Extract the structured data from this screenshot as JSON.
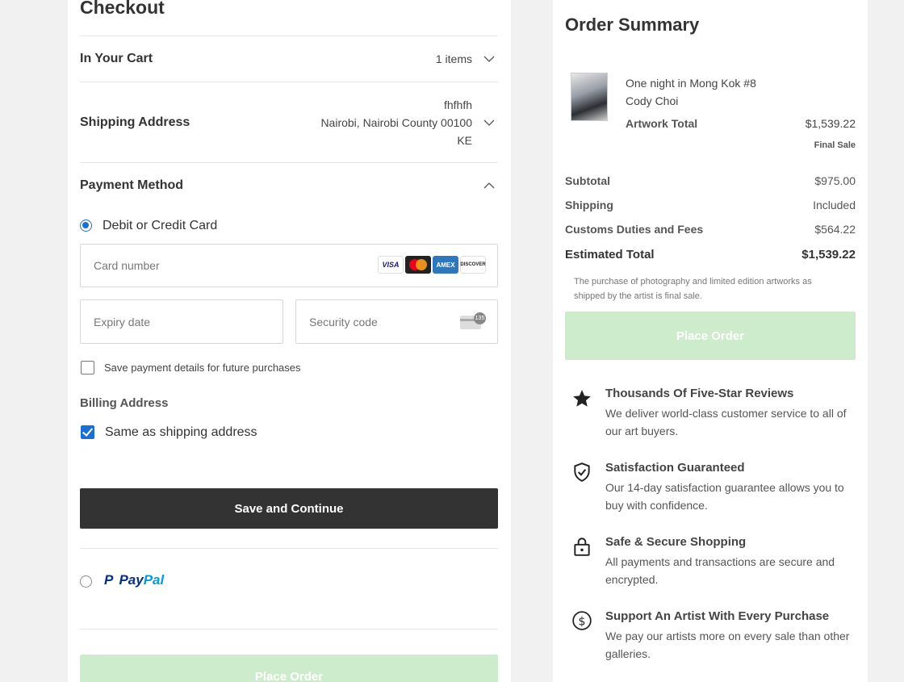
{
  "checkout": {
    "title": "Checkout",
    "cart": {
      "label": "In Your Cart",
      "count": "1 items"
    },
    "shipping": {
      "label": "Shipping Address",
      "line1": "fhfhfh",
      "line2": "Nairobi, Nairobi County 00100",
      "line3": "KE"
    },
    "payment": {
      "label": "Payment Method",
      "card_option": "Debit or Credit Card",
      "card_number_placeholder": "Card number",
      "expiry_placeholder": "Expiry date",
      "security_placeholder": "Security code",
      "card_brands": [
        "VISA",
        "Mastercard",
        "American Express",
        "DISCOVER"
      ],
      "cvv_hint": "135",
      "save_details": "Save payment details for future purchases",
      "billing_label": "Billing Address",
      "same_as_shipping": "Same as shipping address",
      "save_continue": "Save and Continue",
      "paypal_p": "P",
      "paypal_pay": "Pay",
      "paypal_pal": "Pal"
    },
    "place_order": "Place Order"
  },
  "summary": {
    "title": "Order Summary",
    "artwork_title": "One night in Mong Kok #8",
    "artist": "Cody Choi",
    "artwork_total_label": "Artwork Total",
    "artwork_total_value": "$1,539.22",
    "final_sale": "Final Sale",
    "subtotal_label": "Subtotal",
    "subtotal_value": "$975.00",
    "shipping_label": "Shipping",
    "shipping_value": "Included",
    "customs_label": "Customs Duties and Fees",
    "customs_value": "$564.22",
    "estimated_label": "Estimated Total",
    "estimated_value": "$1,539.22",
    "note": "The purchase of photography and limited edition artworks as shipped by the artist is final sale.",
    "place_order": "Place Order"
  },
  "benefits": [
    {
      "icon": "star-icon",
      "title": "Thousands Of Five-Star Reviews",
      "text": "We deliver world-class customer service to all of our art buyers."
    },
    {
      "icon": "shield-check-icon",
      "title": "Satisfaction Guaranteed",
      "text": "Our 14-day satisfaction guarantee allows you to buy with confidence."
    },
    {
      "icon": "lock-icon",
      "title": "Safe & Secure Shopping",
      "text": "All payments and transactions are secure and encrypted."
    },
    {
      "icon": "dollar-circle-icon",
      "title": "Support An Artist With Every Purchase",
      "text": "We pay our artists more on every sale than other galleries."
    }
  ],
  "colors": {
    "accent": "#1a6fd6",
    "button_dark": "#333333",
    "button_disabled": "#cdeccb",
    "paypal_dark": "#003087",
    "paypal_light": "#009cde"
  }
}
